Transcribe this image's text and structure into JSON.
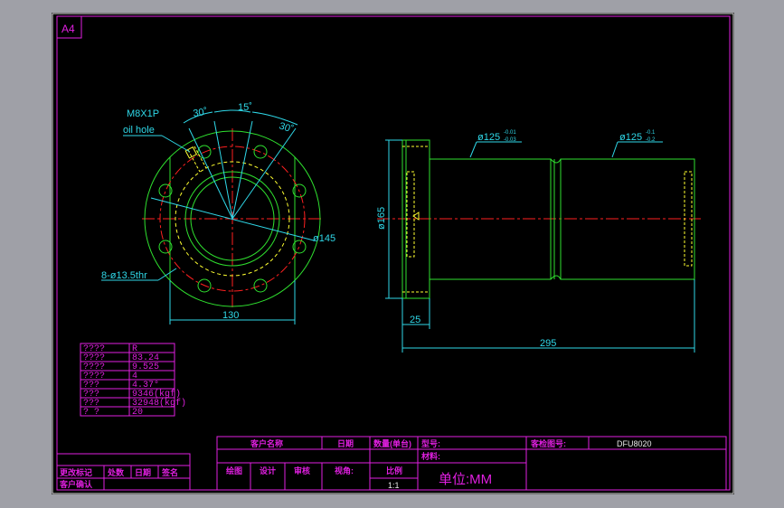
{
  "sheet": {
    "format_label": "A4"
  },
  "front_view": {
    "thread_label": "M8X1P",
    "oil_hole_label": "oil hole",
    "angle_left": "30˚",
    "angle_mid": "15˚",
    "angle_right": "30˚",
    "pcd_label": "ø145",
    "holes_label": "8-ø13.5thr",
    "width_label": "130"
  },
  "side_view": {
    "dia_left": "ø125",
    "dia_left_tol_upper": "-0.01",
    "dia_left_tol_lower": "-0.03",
    "dia_right": "ø125",
    "dia_right_tol_upper": "-0.1",
    "dia_right_tol_lower": "-0.2",
    "flange_dia": "ø165",
    "flange_len": "25",
    "total_len": "295"
  },
  "spec_table": {
    "rows": [
      {
        "key": "????",
        "value": "R"
      },
      {
        "key": "????",
        "value": "83.24"
      },
      {
        "key": "????",
        "value": "9.525"
      },
      {
        "key": "????",
        "value": "4"
      },
      {
        "key": "???",
        "value": "4.37°"
      },
      {
        "key": "???",
        "value": "9346(kgf)"
      },
      {
        "key": "???",
        "value": "32948(kgf)"
      },
      {
        "key": "?  ?",
        "value": "20"
      }
    ]
  },
  "title_block": {
    "customer_name": "客户名称",
    "date": "日期",
    "quantity": "数量(单台)",
    "model": "型号:",
    "spec_drawing_no": "客检图号:",
    "drawing_no": "DFU8020",
    "material": "材料:",
    "drawn": "绘图",
    "designed": "设计",
    "reviewed": "审核",
    "view_angle": "视角:",
    "scale_label": "比例",
    "scale_value": "1:1",
    "unit": "单位:MM",
    "change_record": "更改标记",
    "division": "处数",
    "date2": "日期",
    "signature": "签名",
    "customer_confirm": "客户确认"
  },
  "colors": {
    "frame": "#e01fe0",
    "outline": "#e8e8e8",
    "part": "#2fe02f",
    "center": "#ff2020",
    "hidden": "#ffff30",
    "dimension": "#2fd8e8"
  }
}
